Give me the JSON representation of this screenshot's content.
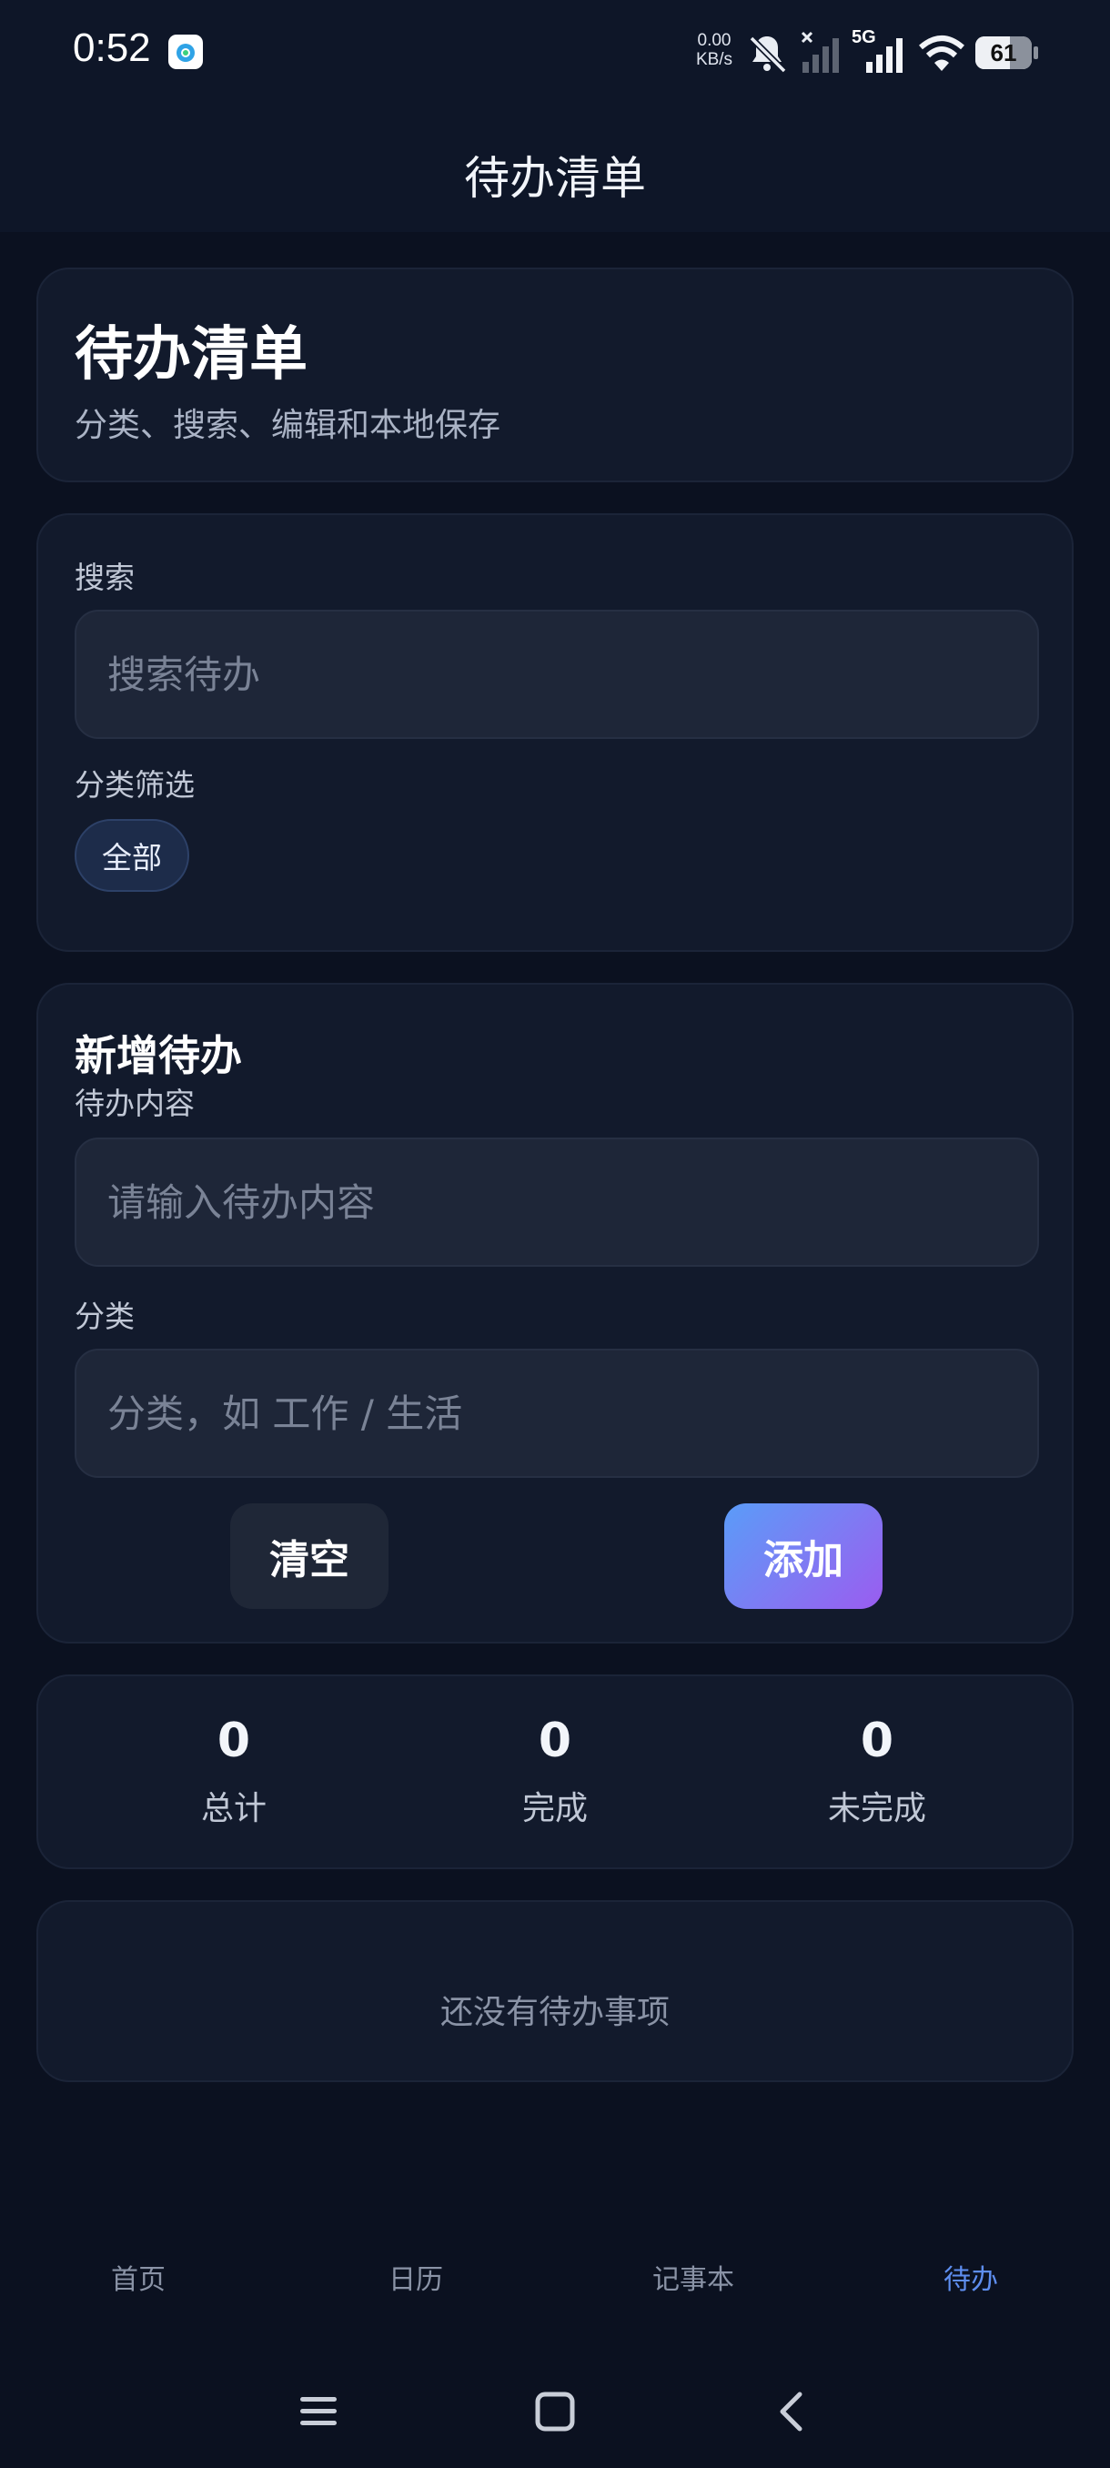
{
  "status_bar": {
    "time": "0:52",
    "net_speed_value": "0.00",
    "net_speed_unit": "KB/s",
    "network_type": "5G",
    "battery_level": "61",
    "icons": [
      "app-notification-icon",
      "bell-off-icon",
      "signal-none-icon",
      "signal-5g-icon",
      "wifi-icon",
      "battery-icon"
    ]
  },
  "header": {
    "title": "待办清单"
  },
  "hero": {
    "title": "待办清单",
    "subtitle": "分类、搜索、编辑和本地保存"
  },
  "filter": {
    "search_label": "搜索",
    "search_placeholder": "搜索待办",
    "search_value": "",
    "category_label": "分类筛选",
    "chips": [
      {
        "label": "全部",
        "selected": true
      }
    ]
  },
  "new_todo": {
    "section_title": "新增待办",
    "content_label": "待办内容",
    "content_placeholder": "请输入待办内容",
    "content_value": "",
    "category_label": "分类",
    "category_placeholder": "分类，如 工作 / 生活",
    "category_value": "",
    "clear_label": "清空",
    "add_label": "添加"
  },
  "stats": [
    {
      "value": "0",
      "label": "总计"
    },
    {
      "value": "0",
      "label": "完成"
    },
    {
      "value": "0",
      "label": "未完成"
    }
  ],
  "empty_state": {
    "text": "还没有待办事项"
  },
  "tab_bar": {
    "tabs": [
      {
        "label": "首页",
        "active": false
      },
      {
        "label": "日历",
        "active": false
      },
      {
        "label": "记事本",
        "active": false
      },
      {
        "label": "待办",
        "active": true
      }
    ]
  },
  "system_nav": {
    "icons": [
      "menu-icon",
      "home-icon",
      "back-icon"
    ]
  },
  "colors": {
    "background": "#0b1120",
    "card": "#121a2c",
    "accent": "#5e8ef0",
    "add_gradient_start": "#5a9cf8",
    "add_gradient_end": "#9a5cf0"
  }
}
